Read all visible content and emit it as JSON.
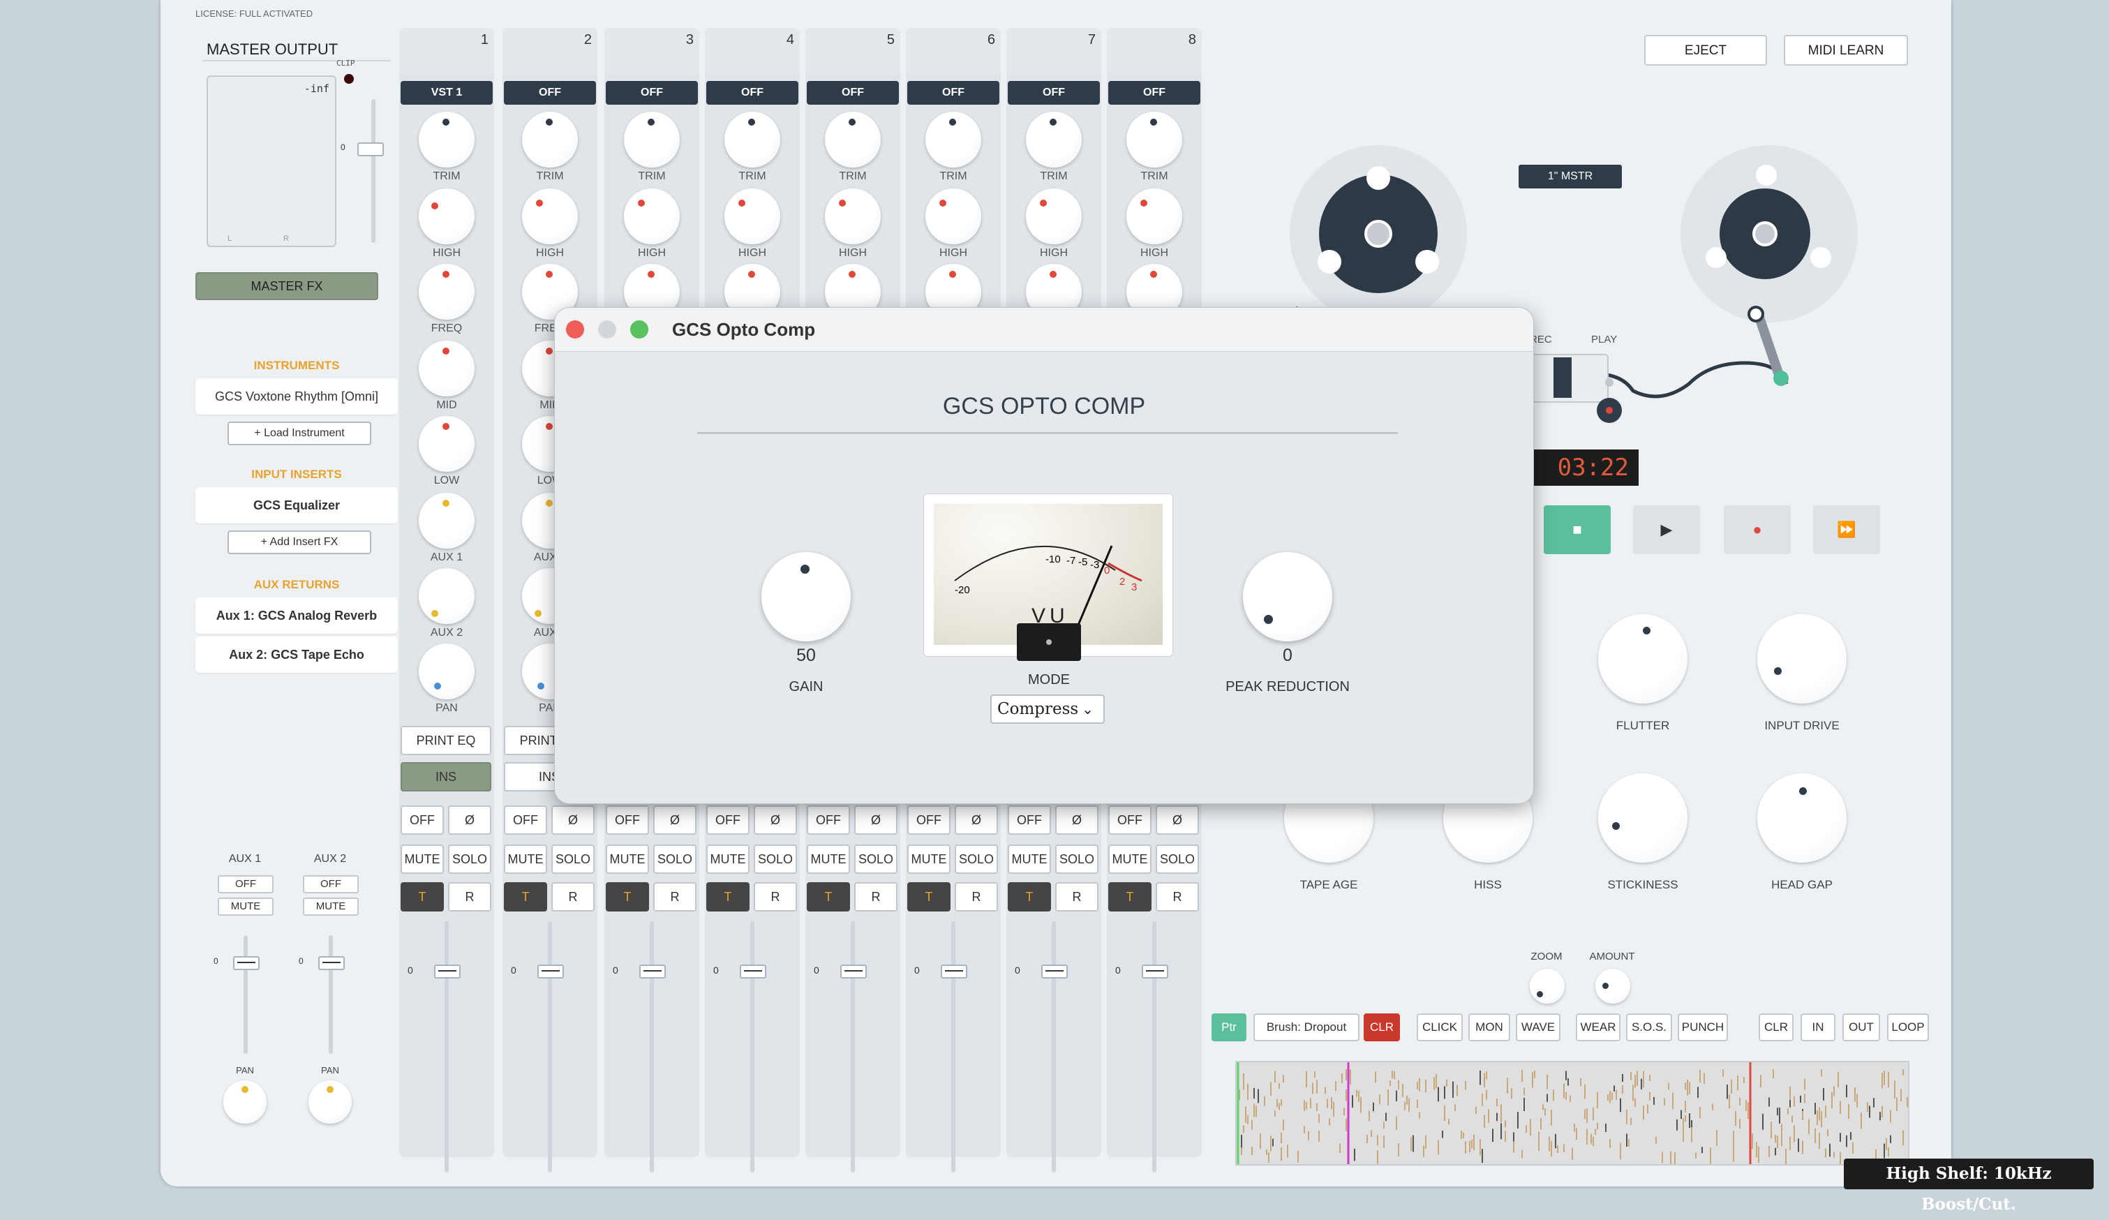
{
  "license": "LICENSE: FULL ACTIVATED",
  "master": {
    "title": "MASTER OUTPUT",
    "clip": "CLIP",
    "level": "-inf",
    "meter_l": "L",
    "meter_r": "R",
    "fader_zero": "0",
    "fx_button": "MASTER FX"
  },
  "instruments": {
    "title": "INSTRUMENTS",
    "item": "GCS Voxtone Rhythm [Omni]",
    "load": "+ Load Instrument"
  },
  "inserts": {
    "title": "INPUT INSERTS",
    "item": "GCS Equalizer",
    "add": "+ Add Insert FX"
  },
  "aux_returns": {
    "title": "AUX RETURNS",
    "items": [
      "Aux 1: GCS Analog Reverb",
      "Aux 2: GCS Tape Echo"
    ]
  },
  "aux": [
    {
      "label": "AUX 1",
      "off": "OFF",
      "mute": "MUTE",
      "zero": "0",
      "pan": "PAN"
    },
    {
      "label": "AUX 2",
      "off": "OFF",
      "mute": "MUTE",
      "zero": "0",
      "pan": "PAN"
    }
  ],
  "knob_labels": [
    "TRIM",
    "HIGH",
    "FREQ",
    "MID",
    "LOW",
    "AUX 1",
    "AUX 2",
    "PAN"
  ],
  "channels": [
    {
      "num": "1",
      "route": "VST 1"
    },
    {
      "num": "2",
      "route": "OFF"
    },
    {
      "num": "3",
      "route": "OFF"
    },
    {
      "num": "4",
      "route": "OFF"
    },
    {
      "num": "5",
      "route": "OFF"
    },
    {
      "num": "6",
      "route": "OFF"
    },
    {
      "num": "7",
      "route": "OFF"
    },
    {
      "num": "8",
      "route": "OFF"
    }
  ],
  "strip_buttons": {
    "print_eq": "PRINT EQ",
    "ins": "INS",
    "off": "OFF",
    "phase": "Ø",
    "mute": "MUTE",
    "solo": "SOLO",
    "t": "T",
    "r": "R",
    "zero": "0"
  },
  "top_buttons": {
    "eject": "EJECT",
    "midi_learn": "MIDI LEARN"
  },
  "tape": {
    "label": "1\" MSTR",
    "rec": "REC",
    "play": "PLAY",
    "time": "03:22"
  },
  "tape_knobs": [
    "FLUTTER",
    "INPUT DRIVE",
    "TAPE AGE",
    "HISS",
    "STICKINESS",
    "HEAD GAP"
  ],
  "small_knobs": [
    "ZOOM",
    "AMOUNT"
  ],
  "toolbar": [
    "Ptr",
    "Brush: Dropout",
    "CLR",
    "CLICK",
    "MON",
    "WAVE",
    "WEAR",
    "S.O.S.",
    "PUNCH",
    "CLR",
    "IN",
    "OUT",
    "LOOP"
  ],
  "plugin": {
    "window_title": "GCS Opto Comp",
    "title": "GCS OPTO COMP",
    "gain_value": "50",
    "gain_label": "GAIN",
    "mode_label": "MODE",
    "mode_value": "Compress",
    "peak_value": "0",
    "peak_label": "PEAK REDUCTION",
    "vu_text": "VU",
    "vu_scale": [
      "-20",
      "-10",
      "-7",
      "-5",
      "-3",
      "0",
      "2",
      "3"
    ]
  },
  "toast": "High Shelf: 10kHz Boost/Cut.",
  "colors": {
    "accent_orange": "#e8a230",
    "route_dark": "#2f3b48",
    "stop_green": "#5bbf9c",
    "record_red": "#e0483c"
  }
}
